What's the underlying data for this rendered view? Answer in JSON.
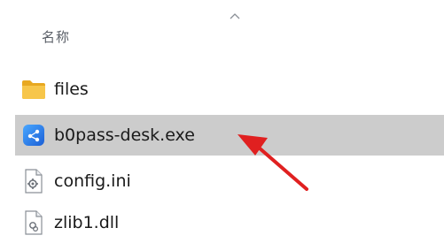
{
  "list": {
    "column_header": "名称",
    "sort_indicator_icon": "chevron-up-icon",
    "files": [
      {
        "name": "files",
        "icon": "folder-icon",
        "selected": false
      },
      {
        "name": "b0pass-desk.exe",
        "icon": "application-icon",
        "selected": true
      },
      {
        "name": "config.ini",
        "icon": "settings-file-icon",
        "selected": false
      },
      {
        "name": "zlib1.dll",
        "icon": "dll-file-icon",
        "selected": false
      }
    ]
  },
  "annotation": {
    "type": "red-arrow",
    "points_to": "b0pass-desk.exe",
    "color": "#e02020"
  },
  "colors": {
    "selection_background": "#cccccc",
    "folder": "#f5c242",
    "exe_icon": "#2d7cf0"
  }
}
